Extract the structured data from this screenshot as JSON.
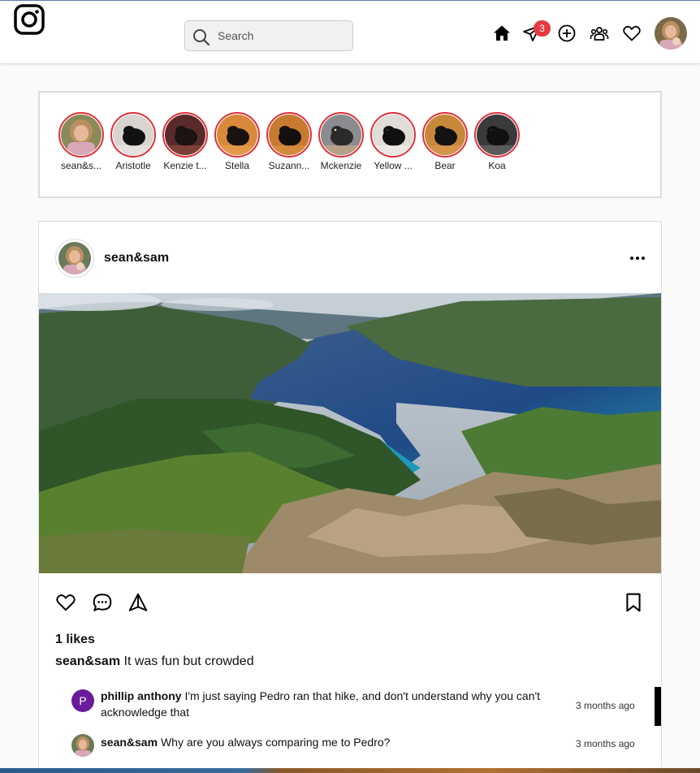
{
  "nav": {
    "search_placeholder": "Search",
    "messages_badge": "3",
    "icons": [
      "instagram-logo-icon",
      "search-icon",
      "home-icon",
      "send-icon",
      "add-post-icon",
      "people-icon",
      "heart-icon"
    ],
    "accent_color": "#e6393f"
  },
  "stories": [
    {
      "name": "sean&s...",
      "kind": "person"
    },
    {
      "name": "Aristotle",
      "kind": "puppy-black-white"
    },
    {
      "name": "Kenzie t...",
      "kind": "puppy-dark-red"
    },
    {
      "name": "Stella",
      "kind": "puppy-orange"
    },
    {
      "name": "Suzann...",
      "kind": "puppy-orange-black"
    },
    {
      "name": "Mckenzie",
      "kind": "puppy-grey"
    },
    {
      "name": "Yellow ...",
      "kind": "puppy-light"
    },
    {
      "name": "Bear",
      "kind": "puppy-wood"
    },
    {
      "name": "Koa",
      "kind": "puppy-dark"
    }
  ],
  "post": {
    "username": "sean&sam",
    "likes": "1 likes",
    "caption_user": "sean&sam",
    "caption_text": "It was fun but crowded",
    "comments": [
      {
        "avatar_letter": "P",
        "user": "phillip anthony",
        "text": "I'm just saying Pedro ran that hike, and don't understand why you can't acknowledge that",
        "time": "3 months ago"
      },
      {
        "avatar_letter": "",
        "user": "sean&sam",
        "text": "Why are you always comparing me to Pedro?",
        "time": "3 months ago"
      }
    ]
  }
}
